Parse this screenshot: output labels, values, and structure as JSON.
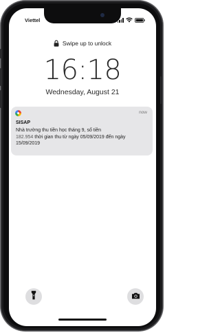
{
  "status_bar": {
    "carrier": "Viettel",
    "icons": [
      "signal-icon",
      "wifi-icon",
      "battery-icon"
    ]
  },
  "lock_screen": {
    "unlock_hint": "Swipe up to unlock",
    "time": "16:18",
    "date": "Wednesday, August 21"
  },
  "notification": {
    "app_icon": "app-logo-icon",
    "time": "now",
    "title": "SISAP",
    "body_part1": "Nhà trường thu tiền học tháng 9, số tiền",
    "amount": "182.954",
    "body_part2": "thời gian thu từ ngày 05/09/2019 đến ngày 15/09/2019"
  },
  "bottom_actions": {
    "left": "flashlight-icon",
    "right": "camera-icon"
  }
}
